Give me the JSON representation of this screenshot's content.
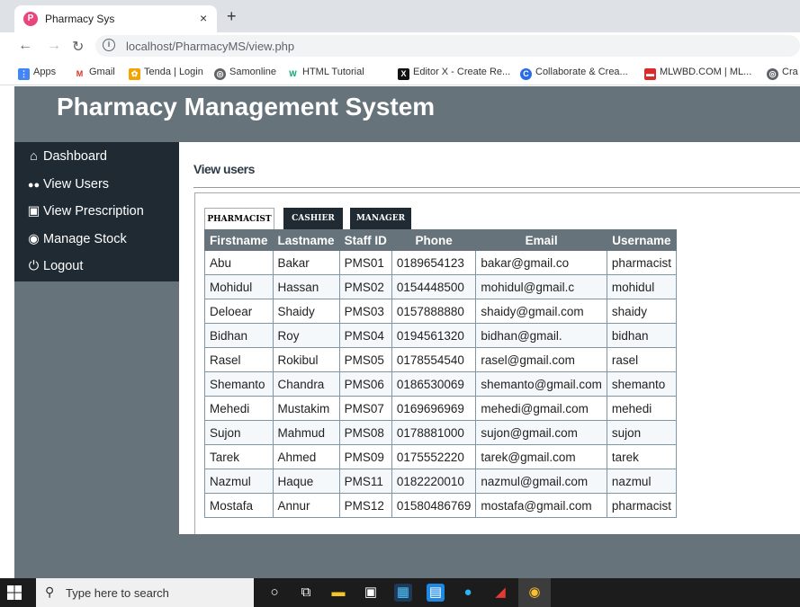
{
  "browser": {
    "tab_title": "Pharmacy Sys",
    "tab_close": "×",
    "new_tab": "+",
    "url_host": "localhost/",
    "url_path": "PharmacyMS/view.php",
    "bookmarks": [
      "Apps",
      "Gmail",
      "Tenda | Login",
      "Samonline",
      "HTML Tutorial",
      "Editor X - Create Re...",
      "Collaborate & Crea...",
      "MLWBD.COM | ML...",
      "Cra"
    ]
  },
  "app": {
    "title": "Pharmacy Management System"
  },
  "sidebar": {
    "items": [
      {
        "label": "Dashboard",
        "icon": "home-icon"
      },
      {
        "label": "View Users",
        "icon": "users-icon"
      },
      {
        "label": "View Prescription",
        "icon": "prescription-icon"
      },
      {
        "label": "Manage Stock",
        "icon": "stock-icon"
      },
      {
        "label": "Logout",
        "icon": "power-icon"
      }
    ]
  },
  "main": {
    "title": "View users",
    "tabs": [
      "PHARMACIST",
      "CASHIER",
      "MANAGER"
    ],
    "table": {
      "headers": [
        "Firstname",
        "Lastname",
        "Staff ID",
        "Phone",
        "Email",
        "Username"
      ],
      "rows": [
        [
          "Abu",
          "Bakar",
          "PMS01",
          "0189654123",
          "bakar@gmail.co",
          "pharmacist"
        ],
        [
          "Mohidul",
          "Hassan",
          "PMS02",
          "0154448500",
          "mohidul@gmail.c",
          "mohidul"
        ],
        [
          "Deloear",
          "Shaidy",
          "PMS03",
          "0157888880",
          "shaidy@gmail.com",
          "shaidy"
        ],
        [
          "Bidhan",
          "Roy",
          "PMS04",
          "0194561320",
          "bidhan@gmail.",
          "bidhan"
        ],
        [
          "Rasel",
          "Rokibul",
          "PMS05",
          "0178554540",
          "rasel@gmail.com",
          "rasel"
        ],
        [
          "Shemanto",
          "Chandra",
          "PMS06",
          "0186530069",
          "shemanto@gmail.com",
          "shemanto"
        ],
        [
          "Mehedi",
          "Mustakim",
          "PMS07",
          "0169696969",
          "mehedi@gmail.com",
          "mehedi"
        ],
        [
          "Sujon",
          "Mahmud",
          "PMS08",
          "0178881000",
          "sujon@gmail.com",
          "sujon"
        ],
        [
          "Tarek",
          "Ahmed",
          "PMS09",
          "0175552220",
          "tarek@gmail.com",
          "tarek"
        ],
        [
          "Nazmul",
          "Haque",
          "PMS11",
          "0182220010",
          "nazmul@gmail.com",
          "nazmul"
        ],
        [
          "Mostafa",
          "Annur",
          "PMS12",
          "01580486769",
          "mostafa@gmail.com",
          "pharmacist"
        ]
      ]
    }
  },
  "taskbar": {
    "search_placeholder": "Type here to search"
  },
  "colors": {
    "header_bg": "#67737b",
    "sidebar_bg": "#1f2a33",
    "table_header_bg": "#67737b"
  }
}
